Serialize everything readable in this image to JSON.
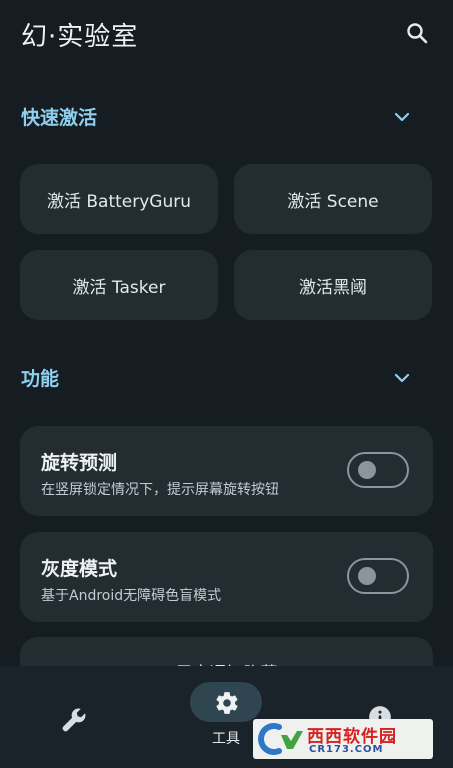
{
  "app": {
    "title": "幻·实验室"
  },
  "sections": {
    "quick": {
      "title": "快速激活"
    },
    "features": {
      "title": "功能"
    }
  },
  "activate_buttons": [
    {
      "label": "激活 BatteryGuru"
    },
    {
      "label": "激活 Scene"
    },
    {
      "label": "激活 Tasker"
    },
    {
      "label": "激活黑阈"
    }
  ],
  "features": [
    {
      "title": "旋转预测",
      "desc": "在竖屏锁定情况下，提示屏幕旋转按钮",
      "enabled": false
    },
    {
      "title": "灰度模式",
      "desc": "基于Android无障碍色盲模式",
      "enabled": false
    }
  ],
  "partial_card": {
    "label": "思宗通知隐藏"
  },
  "bottom_nav": {
    "items": [
      {
        "icon": "wrench-icon"
      },
      {
        "icon": "gear-icon",
        "label": "工具",
        "selected": true
      },
      {
        "icon": "info-icon"
      }
    ]
  },
  "watermark": {
    "text": "西西软件园",
    "url": "CR173.COM"
  },
  "colors": {
    "accent": "#8fd0ee",
    "background": "#151d22",
    "card": "#222c31",
    "selected_pill": "#2f4650"
  }
}
